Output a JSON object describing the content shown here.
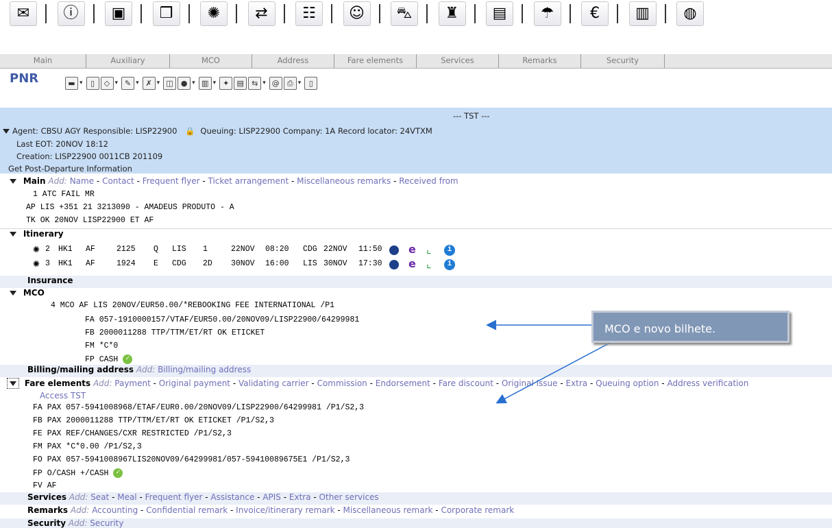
{
  "toolbar": {
    "icons": [
      {
        "name": "compose-icon",
        "glyph": "✉"
      },
      {
        "name": "info-icon",
        "glyph": "ⓘ"
      },
      {
        "name": "terminal-icon",
        "glyph": "▣"
      },
      {
        "name": "book-icon",
        "glyph": "❒"
      },
      {
        "name": "bug-icon",
        "glyph": "✺"
      },
      {
        "name": "swap-icon",
        "glyph": "⇄"
      },
      {
        "name": "train-icon",
        "glyph": "☷"
      },
      {
        "name": "agent-icon",
        "glyph": "☺"
      },
      {
        "name": "car-icon",
        "glyph": "⛍"
      },
      {
        "name": "porter-icon",
        "glyph": "♜"
      },
      {
        "name": "document-icon",
        "glyph": "▤"
      },
      {
        "name": "umbrella-icon",
        "glyph": "☂"
      },
      {
        "name": "money-icon",
        "glyph": "€"
      },
      {
        "name": "chart-icon",
        "glyph": "▥"
      },
      {
        "name": "globe-icon",
        "glyph": "◍"
      }
    ]
  },
  "tabs": [
    "Main",
    "Auxiliary",
    "MCO",
    "Address",
    "Fare elements",
    "Services",
    "Remarks",
    "Security"
  ],
  "pnr": {
    "title": "PNR"
  },
  "header": {
    "tst": "--- TST ---",
    "agent_line": "Agent: CBSU AGY   Responsible: LISP22900",
    "queuing": "Queuing: LISP22900   Company: 1A   Record locator: 24VTXM",
    "last_eot": "Last EOT: 20NOV  18:12",
    "creation": "Creation: LISP22900  0011CB  201109",
    "post_departure_link": "Get Post-Departure Information"
  },
  "main": {
    "title": "Main",
    "add_label": "Add:",
    "links": [
      "Name",
      "Contact",
      "Frequent flyer",
      "Ticket arrangement",
      "Miscellaneous remarks",
      "Received from"
    ],
    "lines": [
      "1 ATC FAIL MR",
      "AP LIS +351 21 3213090 - AMADEUS PRODUTO - A",
      "TK OK 20NOV LISP22900 ET AF"
    ]
  },
  "itinerary": {
    "title": "Itinerary",
    "segments": [
      {
        "no": "2",
        "status": "HK1",
        "airline": "AF",
        "flight": "2125",
        "class": "Q",
        "from": "LIS",
        "term": "1",
        "date": "22NOV",
        "dep": "08:20",
        "to": "CDG",
        "arr_date": "22NOV",
        "arr": "11:50"
      },
      {
        "no": "3",
        "status": "HK1",
        "airline": "AF",
        "flight": "1924",
        "class": "E",
        "from": "CDG",
        "term": "2D",
        "date": "30NOV",
        "dep": "16:00",
        "to": "LIS",
        "arr_date": "30NOV",
        "arr": "17:30"
      }
    ]
  },
  "insurance": {
    "title": "Insurance"
  },
  "mco": {
    "title": "MCO",
    "lines": [
      "4 MCO AF LIS 20NOV/EUR50.00/*REBOOKING FEE INTERNATIONAL /P1",
      "FA 057-1910000157/VTAF/EUR50.00/20NOV09/LISP22900/64299981",
      "FB 2000011288 TTP/TTM/ET/RT OK ETICKET",
      "FM *C*0",
      "FP CASH"
    ]
  },
  "billing": {
    "title": "Billing/mailing address",
    "add_label": "Add:",
    "link": "Billing/mailing address"
  },
  "fare": {
    "title": "Fare elements",
    "add_label": "Add:",
    "links": [
      "Payment",
      "Original payment",
      "Validating carrier",
      "Commission",
      "Endorsement",
      "Fare discount",
      "Original issue",
      "Extra",
      "Queuing option",
      "Address verification"
    ],
    "access_tst": "Access TST",
    "lines": [
      "FA PAX 057-5941008968/ETAF/EUR0.00/20NOV09/LISP22900/64299981 /P1/S2,3",
      "FB PAX 2000011288 TTP/TTM/ET/RT OK ETICKET /P1/S2,3",
      "FE PAX REF/CHANGES/CXR RESTRICTED /P1/S2,3",
      "FM PAX *C*0.00 /P1/S2,3",
      "FO PAX 057-5941008967LIS20NOV09/64299981/057-59410089675E1 /P1/S2,3",
      "FP O/CASH +/CASH",
      "FV AF"
    ]
  },
  "services": {
    "title": "Services",
    "add_label": "Add:",
    "links": [
      "Seat",
      "Meal",
      "Frequent flyer",
      "Assistance",
      "APIS",
      "Extra",
      "Other services"
    ]
  },
  "remarks": {
    "title": "Remarks",
    "add_label": "Add:",
    "links": [
      "Accounting",
      "Confidential remark",
      "Invoice/itinerary remark",
      "Miscellaneous remark",
      "Corporate remark"
    ]
  },
  "security": {
    "title": "Security",
    "add_label": "Add:",
    "link": "Security"
  },
  "callout": {
    "text": "MCO e novo bilhete."
  }
}
